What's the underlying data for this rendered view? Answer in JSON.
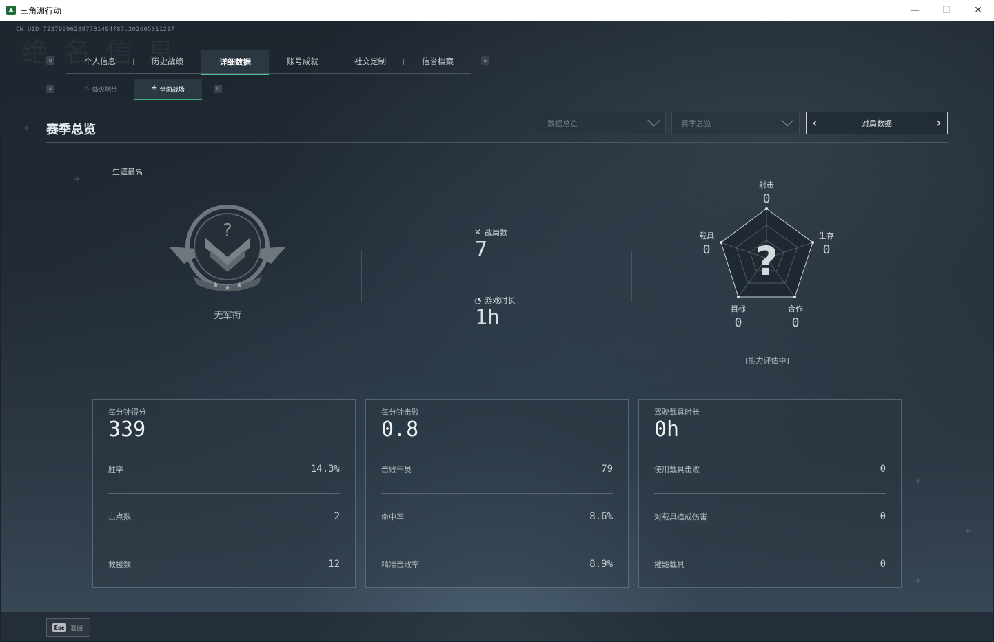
{
  "window": {
    "title": "三角洲行动",
    "min": "—",
    "max": "☐",
    "close": "✕"
  },
  "uid": "CN UID:723799962887781494?87.202605011217",
  "watermark": "绝 名 信 息",
  "keys": {
    "q": "Q",
    "e": "E",
    "a": "A",
    "d": "D"
  },
  "tabs": [
    {
      "label": "个人信息"
    },
    {
      "label": "历史战绩"
    },
    {
      "label": "详细数据",
      "active": true
    },
    {
      "label": "账号成就"
    },
    {
      "label": "社交定制"
    },
    {
      "label": "信誉档案"
    }
  ],
  "subtabs": [
    {
      "label": "烽火地带",
      "icon": "fire-icon"
    },
    {
      "label": "全面战场",
      "icon": "battlefield-icon",
      "active": true
    }
  ],
  "section_title": "赛季总览",
  "filters": {
    "data_overview": "数据总览",
    "season_overview": "赛季总览",
    "pager_label": "对局数据",
    "prev": "‹",
    "next": "›"
  },
  "career": {
    "label": "生涯最高",
    "rank_name": "无军衔"
  },
  "stats": {
    "matches_label": "战局数",
    "matches_value": "7",
    "playtime_label": "游戏时长",
    "playtime_value": "1h"
  },
  "radar": {
    "center": "?",
    "axes": [
      {
        "label": "射击",
        "value": "0"
      },
      {
        "label": "生存",
        "value": "0"
      },
      {
        "label": "合作",
        "value": "0"
      },
      {
        "label": "目标",
        "value": "0"
      },
      {
        "label": "载具",
        "value": "0"
      }
    ],
    "eval_text": "[能力评估中]"
  },
  "cards": [
    {
      "title": "每分钟得分",
      "value": "339",
      "rows": [
        {
          "label": "胜率",
          "value": "14.3%"
        },
        {
          "label": "占点数",
          "value": "2"
        },
        {
          "label": "救援数",
          "value": "12"
        }
      ]
    },
    {
      "title": "每分钟击败",
      "value": "0.8",
      "rows": [
        {
          "label": "击败干员",
          "value": "79"
        },
        {
          "label": "命中率",
          "value": "8.6%"
        },
        {
          "label": "精准击败率",
          "value": "8.9%"
        }
      ]
    },
    {
      "title": "驾驶载具时长",
      "value": "0h",
      "rows": [
        {
          "label": "使用载具击败",
          "value": "0"
        },
        {
          "label": "对载具造成伤害",
          "value": "0"
        },
        {
          "label": "摧毁载具",
          "value": "0"
        }
      ]
    }
  ],
  "footer": {
    "esc_key": "Esc",
    "esc_label": "返回"
  }
}
